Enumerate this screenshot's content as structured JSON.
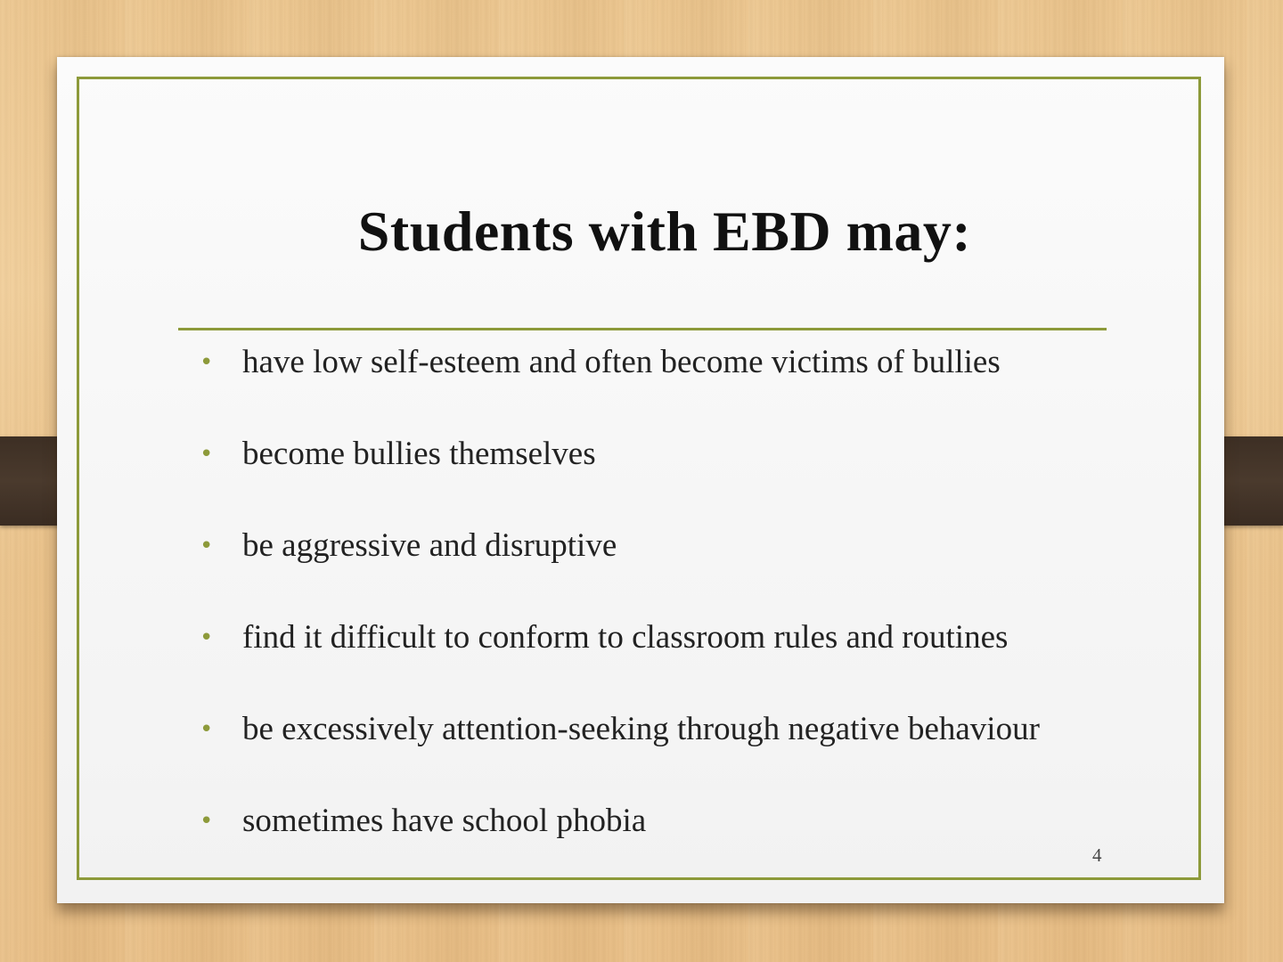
{
  "slide": {
    "title": "Students with EBD may:",
    "bullets": [
      "have low self-esteem and often become victims of bullies",
      "become bullies themselves",
      "be aggressive and disruptive",
      "find it difficult to conform to classroom rules and routines",
      "be excessively attention-seeking through negative behaviour",
      "sometimes have school phobia"
    ],
    "bullet_glyph": "•",
    "page_number": "4"
  },
  "colors": {
    "accent": "#8d9a3a",
    "background_wood": "#ecc791",
    "strap": "#3d2f24",
    "card": "#f7f7f7",
    "text": "#222222"
  }
}
